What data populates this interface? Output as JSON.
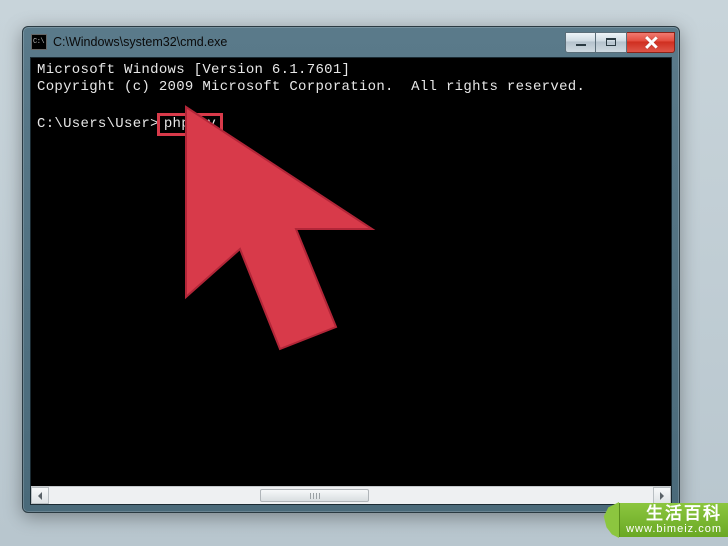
{
  "window": {
    "title": "C:\\Windows\\system32\\cmd.exe",
    "icon_label": "C:\\"
  },
  "terminal": {
    "line1": "Microsoft Windows [Version 6.1.7601]",
    "line2": "Copyright (c) 2009 Microsoft Corporation.  All rights reserved.",
    "blank": "",
    "prompt": "C:\\Users\\User>",
    "command": "php -v"
  },
  "watermark": {
    "label": "生活百科",
    "url": "www.bimeiz.com"
  }
}
